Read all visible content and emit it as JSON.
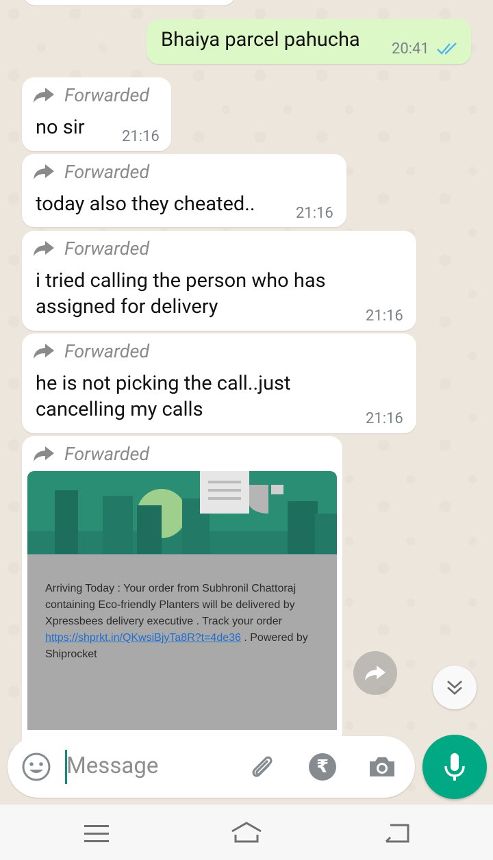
{
  "chat": {
    "outgoing": {
      "text": "Bhaiya parcel pahucha",
      "time": "20:41"
    },
    "forwarded_label": "Forwarded",
    "messages": [
      {
        "text": "no sir",
        "time": "21:16"
      },
      {
        "text": "today also they cheated..",
        "time": "21:16"
      },
      {
        "text_line1": "i tried calling the person who has",
        "text_line2": "assigned for delivery",
        "time": "21:16"
      },
      {
        "text_line1": "he is not picking the call..just",
        "text_line2": "cancelling my calls",
        "time": "21:16"
      }
    ],
    "media": {
      "text_before_link": "Arriving Today : Your order from Subhronil Chattoraj containing Eco-friendly Planters will be delivered by Xpressbees delivery executive  . Track your order ",
      "link": "https://shprkt.in/QKwsiBjyTa8R?t=4de36",
      "text_after_link": " . Powered by Shiprocket"
    }
  },
  "input": {
    "placeholder": "Message"
  },
  "icons": {
    "emoji": "emoji-icon",
    "attach": "paperclip-icon",
    "payment": "rupee-icon",
    "camera": "camera-icon",
    "mic": "microphone-icon",
    "forward_media": "forward-icon",
    "scroll_down": "double-chevron-down-icon",
    "nav_menu": "menu-icon",
    "nav_home": "home-icon",
    "nav_back": "back-icon"
  },
  "colors": {
    "outgoing_bubble": "#dcf8c6",
    "incoming_bubble": "#ffffff",
    "accent": "#00a884",
    "read_ticks": "#4fb6ec"
  }
}
